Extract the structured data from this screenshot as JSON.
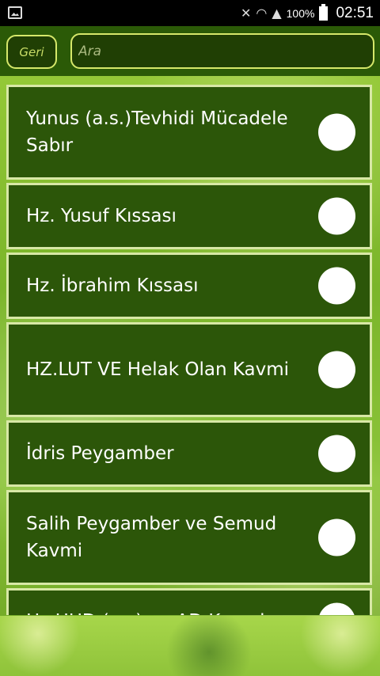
{
  "status_bar": {
    "battery_percent": "100%",
    "time": "02:51"
  },
  "toolbar": {
    "back_label": "Geri",
    "search_placeholder": "Ara"
  },
  "items": [
    {
      "label": "Yunus (a.s.)Tevhidi Mücadele Sabır",
      "selected": false
    },
    {
      "label": "Hz. Yusuf Kıssası",
      "selected": false
    },
    {
      "label": "Hz. İbrahim Kıssası",
      "selected": false
    },
    {
      "label": "HZ.LUT VE Helak Olan Kavmi",
      "selected": false
    },
    {
      "label": "İdris Peygamber",
      "selected": false
    },
    {
      "label": "Salih Peygamber ve Semud Kavmi",
      "selected": false
    },
    {
      "label": "Hz.HUD (a.s) ve AD Kavmi",
      "selected": false
    }
  ]
}
